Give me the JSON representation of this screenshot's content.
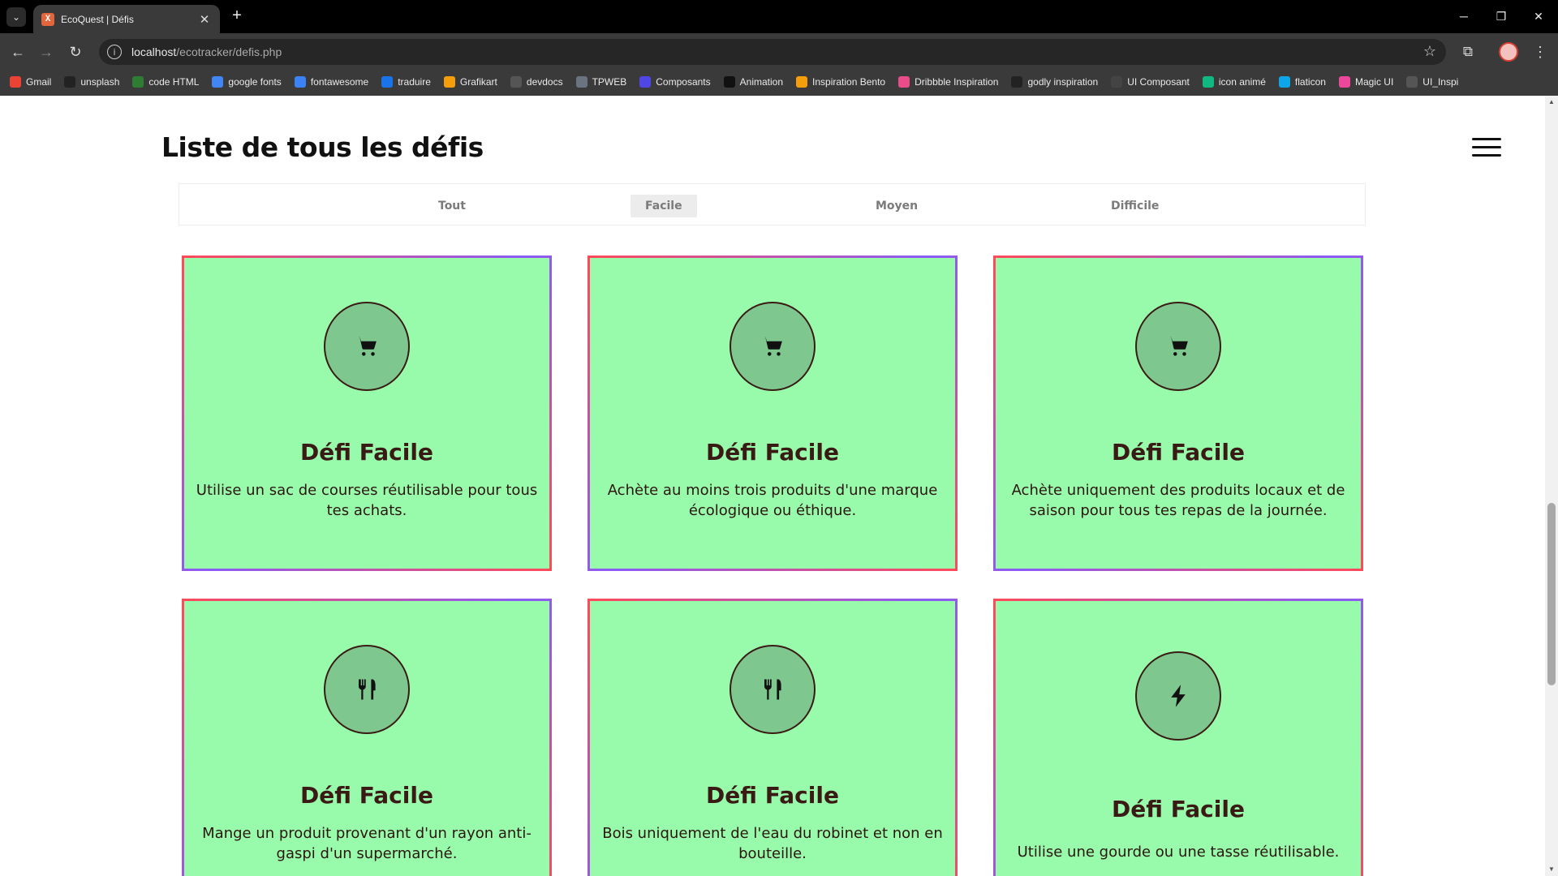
{
  "browser": {
    "tab_title": "EcoQuest | Défis",
    "tab_favicon_letter": "X",
    "url_host": "localhost",
    "url_path": "/ecotracker/defis.php",
    "bookmarks": [
      {
        "label": "Gmail",
        "icon": "gmail-icon",
        "color": "#ea4335"
      },
      {
        "label": "unsplash",
        "icon": "unsplash-icon",
        "color": "#222222"
      },
      {
        "label": "code HTML",
        "icon": "code-html-icon",
        "color": "#2e7d32"
      },
      {
        "label": "google fonts",
        "icon": "google-fonts-icon",
        "color": "#4285f4"
      },
      {
        "label": "fontawesome",
        "icon": "flag-icon",
        "color": "#3b82f6"
      },
      {
        "label": "traduire",
        "icon": "translate-icon",
        "color": "#1a73e8"
      },
      {
        "label": "Grafikart",
        "icon": "grafikart-icon",
        "color": "#f59e0b"
      },
      {
        "label": "devdocs",
        "icon": "devdocs-icon",
        "color": "#555555"
      },
      {
        "label": "TPWEB",
        "icon": "tpweb-icon",
        "color": "#6b7280"
      },
      {
        "label": "Composants",
        "icon": "ui-icon",
        "color": "#4f46e5"
      },
      {
        "label": "Animation",
        "icon": "chevron-right-icon",
        "color": "#111111"
      },
      {
        "label": "Inspiration Bento",
        "icon": "bento-icon",
        "color": "#f59e0b"
      },
      {
        "label": "Dribbble Inspiration",
        "icon": "dribbble-icon",
        "color": "#ea4c89"
      },
      {
        "label": "godly inspiration",
        "icon": "bolt-icon",
        "color": "#222222"
      },
      {
        "label": "UI Composant",
        "icon": "globe-icon",
        "color": "#444444"
      },
      {
        "label": "icon animé",
        "icon": "icon-anime-icon",
        "color": "#10b981"
      },
      {
        "label": "flaticon",
        "icon": "flaticon-icon",
        "color": "#0ea5e9"
      },
      {
        "label": "Magic UI",
        "icon": "magic-ui-icon",
        "color": "#ec4899"
      },
      {
        "label": "UI_Inspi",
        "icon": "folder-icon",
        "color": "#555555"
      }
    ]
  },
  "page": {
    "title": "Liste de tous les défis",
    "filters": [
      "Tout",
      "Facile",
      "Moyen",
      "Difficile"
    ],
    "active_filter": "Facile",
    "cards": [
      {
        "icon": "cart-icon",
        "title": "Défi Facile",
        "description": "Utilise un sac de courses réutilisable pour tous tes achats."
      },
      {
        "icon": "cart-icon",
        "title": "Défi Facile",
        "description": "Achète au moins trois produits d'une marque écologique ou éthique."
      },
      {
        "icon": "cart-icon",
        "title": "Défi Facile",
        "description": "Achète uniquement des produits locaux et de saison pour tous tes repas de la journée."
      },
      {
        "icon": "utensils-icon",
        "title": "Défi Facile",
        "description": "Mange un produit provenant d'un rayon anti-gaspi d'un supermarché."
      },
      {
        "icon": "utensils-icon",
        "title": "Défi Facile",
        "description": "Bois uniquement de l'eau du robinet et non en bouteille."
      },
      {
        "icon": "bolt-icon",
        "title": "Défi Facile",
        "description": "Utilise une gourde ou une tasse réutilisable."
      }
    ]
  },
  "colors": {
    "card_background": "#98fbab",
    "icon_circle": "#7ec88f",
    "text_dark": "#3a1a14",
    "card_border_start": "#ff4a5a",
    "card_border_mid": "#8a5cf6"
  }
}
